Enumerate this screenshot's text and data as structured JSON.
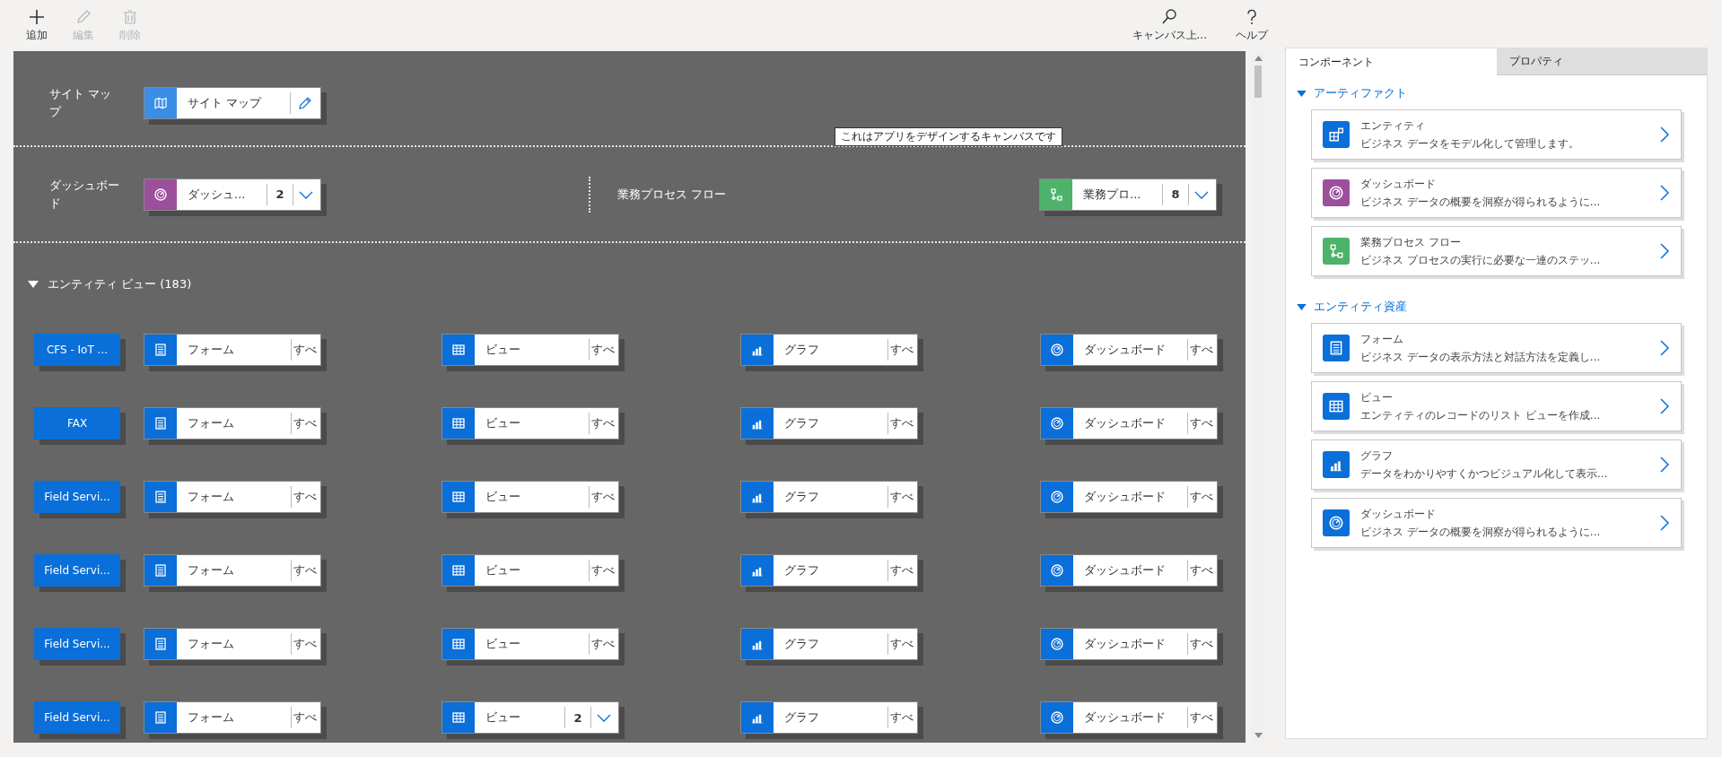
{
  "toolbar": {
    "left": [
      {
        "kind": "add",
        "label": "追加",
        "disabled": false
      },
      {
        "kind": "edit",
        "label": "編集",
        "disabled": true
      },
      {
        "kind": "delete",
        "label": "削除",
        "disabled": true
      }
    ],
    "right": [
      {
        "kind": "search",
        "label": "キャンバス上...",
        "disabled": false
      },
      {
        "kind": "help",
        "label": "ヘルプ",
        "disabled": false
      }
    ]
  },
  "canvas": {
    "tooltip": "これはアプリをデザインするキャンバスです",
    "site_map": {
      "label": "サイト マップ",
      "card": {
        "kind": "map",
        "label": "サイト マップ",
        "color": "#3a8ee6",
        "editable": true
      }
    },
    "dashboards": {
      "label": "ダッシュボード",
      "card": {
        "kind": "dashboard",
        "label": "ダッシュ...",
        "count": "2",
        "color": "#9c4f9b"
      }
    },
    "process_flows": {
      "label": "業務プロセス フロー",
      "card": {
        "kind": "flow",
        "label": "業務プロ...",
        "count": "8",
        "color": "#4db36a"
      }
    },
    "entity_view": {
      "title": "エンティティ ビュー (183)",
      "expanded": true,
      "rows": [
        {
          "name": "CFS - IoT ...",
          "cells": [
            {
              "kind": "form",
              "label": "フォーム",
              "all": "すべ"
            },
            {
              "kind": "view",
              "label": "ビュー",
              "all": "すべ"
            },
            {
              "kind": "chart",
              "label": "グラフ",
              "all": "すべ"
            },
            {
              "kind": "dashboard",
              "label": "ダッシュボード",
              "all": "すべ"
            }
          ]
        },
        {
          "name": "FAX",
          "cells": [
            {
              "kind": "form",
              "label": "フォーム",
              "all": "すべ"
            },
            {
              "kind": "view",
              "label": "ビュー",
              "all": "すべ"
            },
            {
              "kind": "chart",
              "label": "グラフ",
              "all": "すべ"
            },
            {
              "kind": "dashboard",
              "label": "ダッシュボード",
              "all": "すべ"
            }
          ]
        },
        {
          "name": "Field Servi...",
          "cells": [
            {
              "kind": "form",
              "label": "フォーム",
              "all": "すべ"
            },
            {
              "kind": "view",
              "label": "ビュー",
              "all": "すべ"
            },
            {
              "kind": "chart",
              "label": "グラフ",
              "all": "すべ"
            },
            {
              "kind": "dashboard",
              "label": "ダッシュボード",
              "all": "すべ"
            }
          ]
        },
        {
          "name": "Field Servi...",
          "cells": [
            {
              "kind": "form",
              "label": "フォーム",
              "all": "すべ"
            },
            {
              "kind": "view",
              "label": "ビュー",
              "all": "すべ"
            },
            {
              "kind": "chart",
              "label": "グラフ",
              "all": "すべ"
            },
            {
              "kind": "dashboard",
              "label": "ダッシュボード",
              "all": "すべ"
            }
          ]
        },
        {
          "name": "Field Servi...",
          "cells": [
            {
              "kind": "form",
              "label": "フォーム",
              "all": "すべ"
            },
            {
              "kind": "view",
              "label": "ビュー",
              "all": "すべ"
            },
            {
              "kind": "chart",
              "label": "グラフ",
              "all": "すべ"
            },
            {
              "kind": "dashboard",
              "label": "ダッシュボード",
              "all": "すべ"
            }
          ]
        },
        {
          "name": "Field Servi...",
          "cells": [
            {
              "kind": "form",
              "label": "フォーム",
              "all": "すべ"
            },
            {
              "kind": "view",
              "label": "ビュー",
              "count": "2"
            },
            {
              "kind": "chart",
              "label": "グラフ",
              "all": "すべ"
            },
            {
              "kind": "dashboard",
              "label": "ダッシュボード",
              "all": "すべ"
            }
          ]
        }
      ]
    }
  },
  "panel": {
    "tabs": [
      {
        "label": "コンポーネント",
        "selected": true
      },
      {
        "label": "プロパティ",
        "selected": false
      }
    ],
    "sections": [
      {
        "title": "アーティファクト",
        "expanded": true,
        "items": [
          {
            "kind": "entity",
            "title": "エンティティ",
            "description": "ビジネス データをモデル化して管理します。",
            "color": "#0a6fd8"
          },
          {
            "kind": "dashboard",
            "title": "ダッシュボード",
            "description": "ビジネス データの概要を洞察が得られるように...",
            "color": "#9c4f9b"
          },
          {
            "kind": "flow",
            "title": "業務プロセス フロー",
            "description": "ビジネス プロセスの実行に必要な一連のステッ...",
            "color": "#4db36a"
          }
        ]
      },
      {
        "title": "エンティティ資産",
        "expanded": true,
        "items": [
          {
            "kind": "form",
            "title": "フォーム",
            "description": "ビジネス データの表示方法と対話方法を定義し...",
            "color": "#0a6fd8"
          },
          {
            "kind": "view",
            "title": "ビュー",
            "description": "エンティティのレコードのリスト ビューを作成...",
            "color": "#0a6fd8"
          },
          {
            "kind": "chart",
            "title": "グラフ",
            "description": "データをわかりやすくかつビジュアル化して表示...",
            "color": "#0a6fd8"
          },
          {
            "kind": "dashboard",
            "title": "ダッシュボード",
            "description": "ビジネス データの概要を洞察が得られるように...",
            "color": "#0a6fd8"
          }
        ]
      }
    ]
  }
}
